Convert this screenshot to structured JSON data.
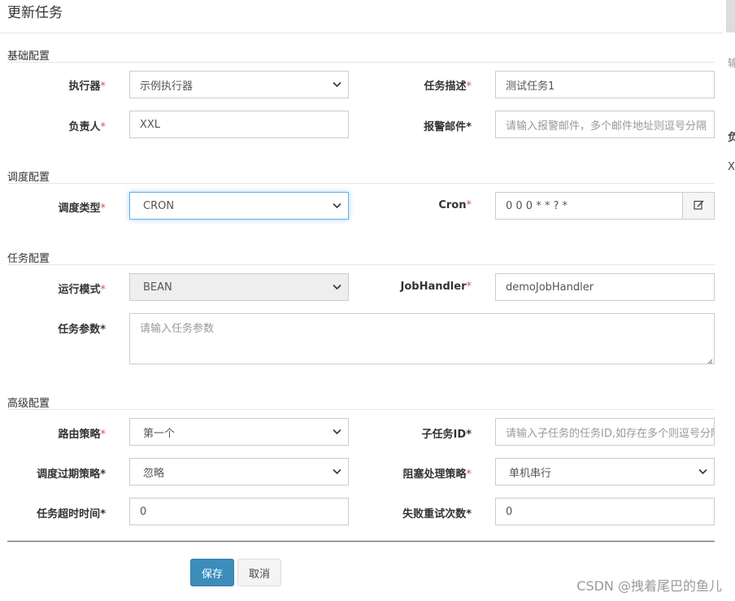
{
  "dialog": {
    "title": "更新任务"
  },
  "sections": {
    "basic": "基础配置",
    "schedule": "调度配置",
    "task": "任务配置",
    "advanced": "高级配置"
  },
  "fields": {
    "executor": {
      "label": "执行器",
      "value": "示例执行器"
    },
    "job_desc": {
      "label": "任务描述",
      "value": "测试任务1"
    },
    "author": {
      "label": "负责人",
      "value": "XXL"
    },
    "alarm_email": {
      "label": "报警邮件",
      "placeholder": "请输入报警邮件，多个邮件地址则逗号分隔"
    },
    "schedule_type": {
      "label": "调度类型",
      "value": "CRON"
    },
    "cron": {
      "label": "Cron",
      "value": "0 0 0 * * ? *"
    },
    "glue_type": {
      "label": "运行模式",
      "value": "BEAN"
    },
    "job_handler": {
      "label": "JobHandler",
      "value": "demoJobHandler"
    },
    "job_param": {
      "label": "任务参数",
      "placeholder": "请输入任务参数"
    },
    "route_strategy": {
      "label": "路由策略",
      "value": "第一个"
    },
    "child_job_id": {
      "label": "子任务ID",
      "placeholder": "请输入子任务的任务ID,如存在多个则逗号分隔"
    },
    "misfire_strategy": {
      "label": "调度过期策略",
      "value": "忽略"
    },
    "block_strategy": {
      "label": "阻塞处理策略",
      "value": "单机串行"
    },
    "timeout": {
      "label": "任务超时时间",
      "value": "0"
    },
    "fail_retry": {
      "label": "失败重试次数",
      "value": "0"
    }
  },
  "required_mark": "*",
  "buttons": {
    "save": "保存",
    "cancel": "取消"
  },
  "background": {
    "text1": "输入",
    "text2": "负",
    "text3": "X"
  },
  "watermark": "CSDN @拽着尾巴的鱼儿",
  "colors": {
    "required": "#d9534f",
    "primary": "#3c8dbc",
    "focus_border": "#66afe9"
  }
}
